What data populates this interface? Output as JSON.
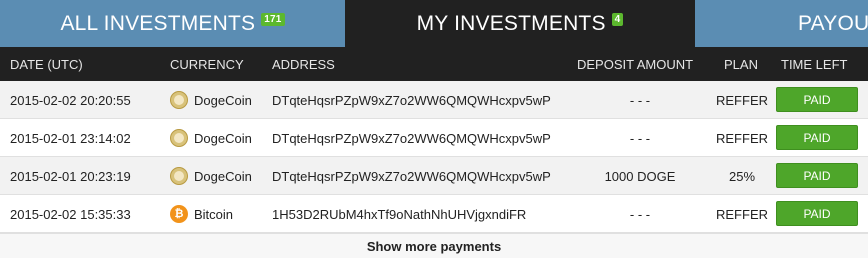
{
  "tabs": [
    {
      "label": "ALL INVESTMENTS",
      "count": "171"
    },
    {
      "label": "MY INVESTMENTS",
      "count": "4"
    },
    {
      "label": "PAYOUT"
    }
  ],
  "columns": [
    "DATE (UTC)",
    "CURRENCY",
    "ADDRESS",
    "DEPOSIT AMOUNT",
    "PLAN",
    "TIME LEFT"
  ],
  "rows": [
    {
      "date": "2015-02-02 20:20:55",
      "currency": "DogeCoin",
      "currency_icon": "dogecoin-icon",
      "address": "DTqteHqsrPZpW9xZ7o2WW6QMQWHcxpv5wP",
      "deposit": "- - -",
      "plan": "REFFER",
      "status": "PAID"
    },
    {
      "date": "2015-02-01 23:14:02",
      "currency": "DogeCoin",
      "currency_icon": "dogecoin-icon",
      "address": "DTqteHqsrPZpW9xZ7o2WW6QMQWHcxpv5wP",
      "deposit": "- - -",
      "plan": "REFFER",
      "status": "PAID"
    },
    {
      "date": "2015-02-01 20:23:19",
      "currency": "DogeCoin",
      "currency_icon": "dogecoin-icon",
      "address": "DTqteHqsrPZpW9xZ7o2WW6QMQWHcxpv5wP",
      "deposit": "1000 DOGE",
      "plan": "25%",
      "status": "PAID"
    },
    {
      "date": "2015-02-02 15:35:33",
      "currency": "Bitcoin",
      "currency_icon": "bitcoin-icon",
      "address": "1H53D2RUbM4hxTf9oNathNhUHVjgxndiFR",
      "deposit": "- - -",
      "plan": "REFFER",
      "status": "PAID"
    }
  ],
  "footer": {
    "show_more": "Show more payments"
  },
  "colors": {
    "tab_active": "#212121",
    "tab_inactive": "#5b8db3",
    "badge": "#5cb82e",
    "paid_button": "#4ea62a",
    "bitcoin": "#f2931a"
  }
}
